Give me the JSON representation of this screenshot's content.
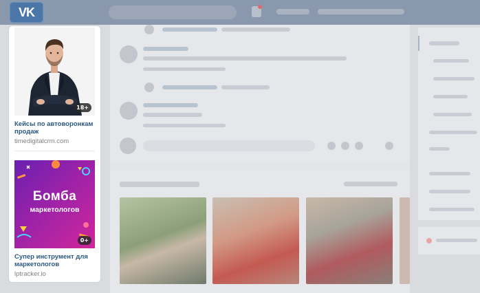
{
  "header": {
    "logo_text": "VK",
    "brand_color": "#4a76a8"
  },
  "ads": [
    {
      "title": "Кейсы по автоворонкам продаж",
      "domain": "timedigitalcrm.com",
      "age_rating": "18+",
      "image": "man-in-suit-photo"
    },
    {
      "title": "Супер инструмент для маркетологов",
      "domain": "lptracker.io",
      "age_rating": "0+",
      "image_text_line1": "Бомба",
      "image_text_line2": "маркетологов"
    }
  ]
}
